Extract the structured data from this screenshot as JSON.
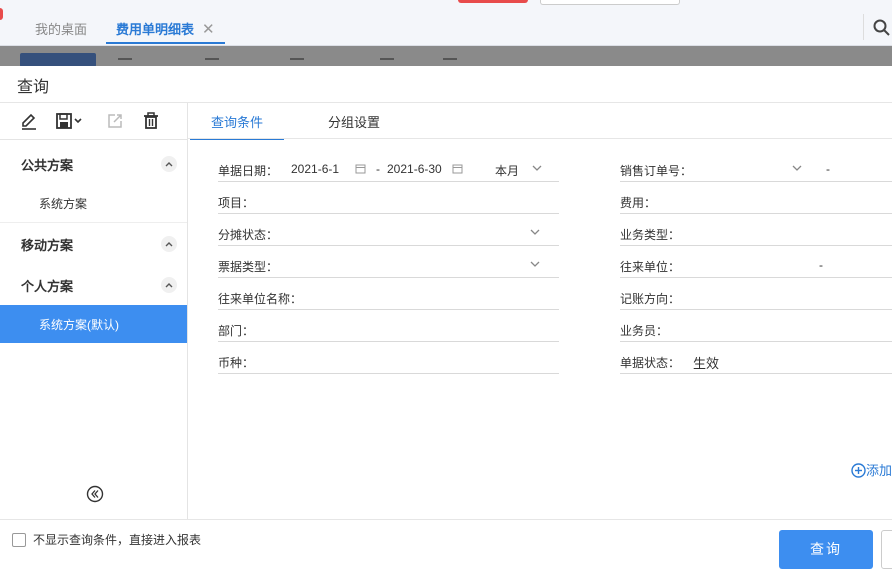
{
  "top_tabs": [
    {
      "label": "我的桌面"
    },
    {
      "label": "费用单明细表",
      "close": "✕"
    }
  ],
  "dialog": {
    "title": "查询"
  },
  "sidebar": {
    "sections": [
      {
        "label": "公共方案",
        "items": [
          {
            "label": "系统方案"
          }
        ]
      },
      {
        "label": "移动方案",
        "items": []
      },
      {
        "label": "个人方案",
        "items": [
          {
            "label": "系统方案(默认)",
            "active": true
          }
        ]
      }
    ]
  },
  "main_tabs": [
    {
      "label": "查询条件",
      "active": true
    },
    {
      "label": "分组设置",
      "active": false
    }
  ],
  "left_fields": [
    {
      "label": "单据日期：",
      "start": "2021-6-1",
      "sep": "-",
      "end": "2021-6-30",
      "period": "本月"
    },
    {
      "label": "项目："
    },
    {
      "label": "分摊状态："
    },
    {
      "label": "票据类型："
    },
    {
      "label": "往来单位名称："
    },
    {
      "label": "部门："
    },
    {
      "label": "币种："
    }
  ],
  "right_fields": [
    {
      "label": "销售订单号：",
      "sep": "-"
    },
    {
      "label": "费用："
    },
    {
      "label": "业务类型："
    },
    {
      "label": "往来单位：",
      "sep": "-"
    },
    {
      "label": "记账方向："
    },
    {
      "label": "业务员："
    },
    {
      "label": "单据状态：",
      "value": "生效"
    }
  ],
  "add_link": "添加",
  "footer": {
    "skip_label": "不显示查询条件，直接进入报表",
    "query_button": "查询"
  },
  "colors": {
    "accent": "#3d8ef0",
    "link": "#2a7ad5",
    "danger": "#e84b4b"
  }
}
